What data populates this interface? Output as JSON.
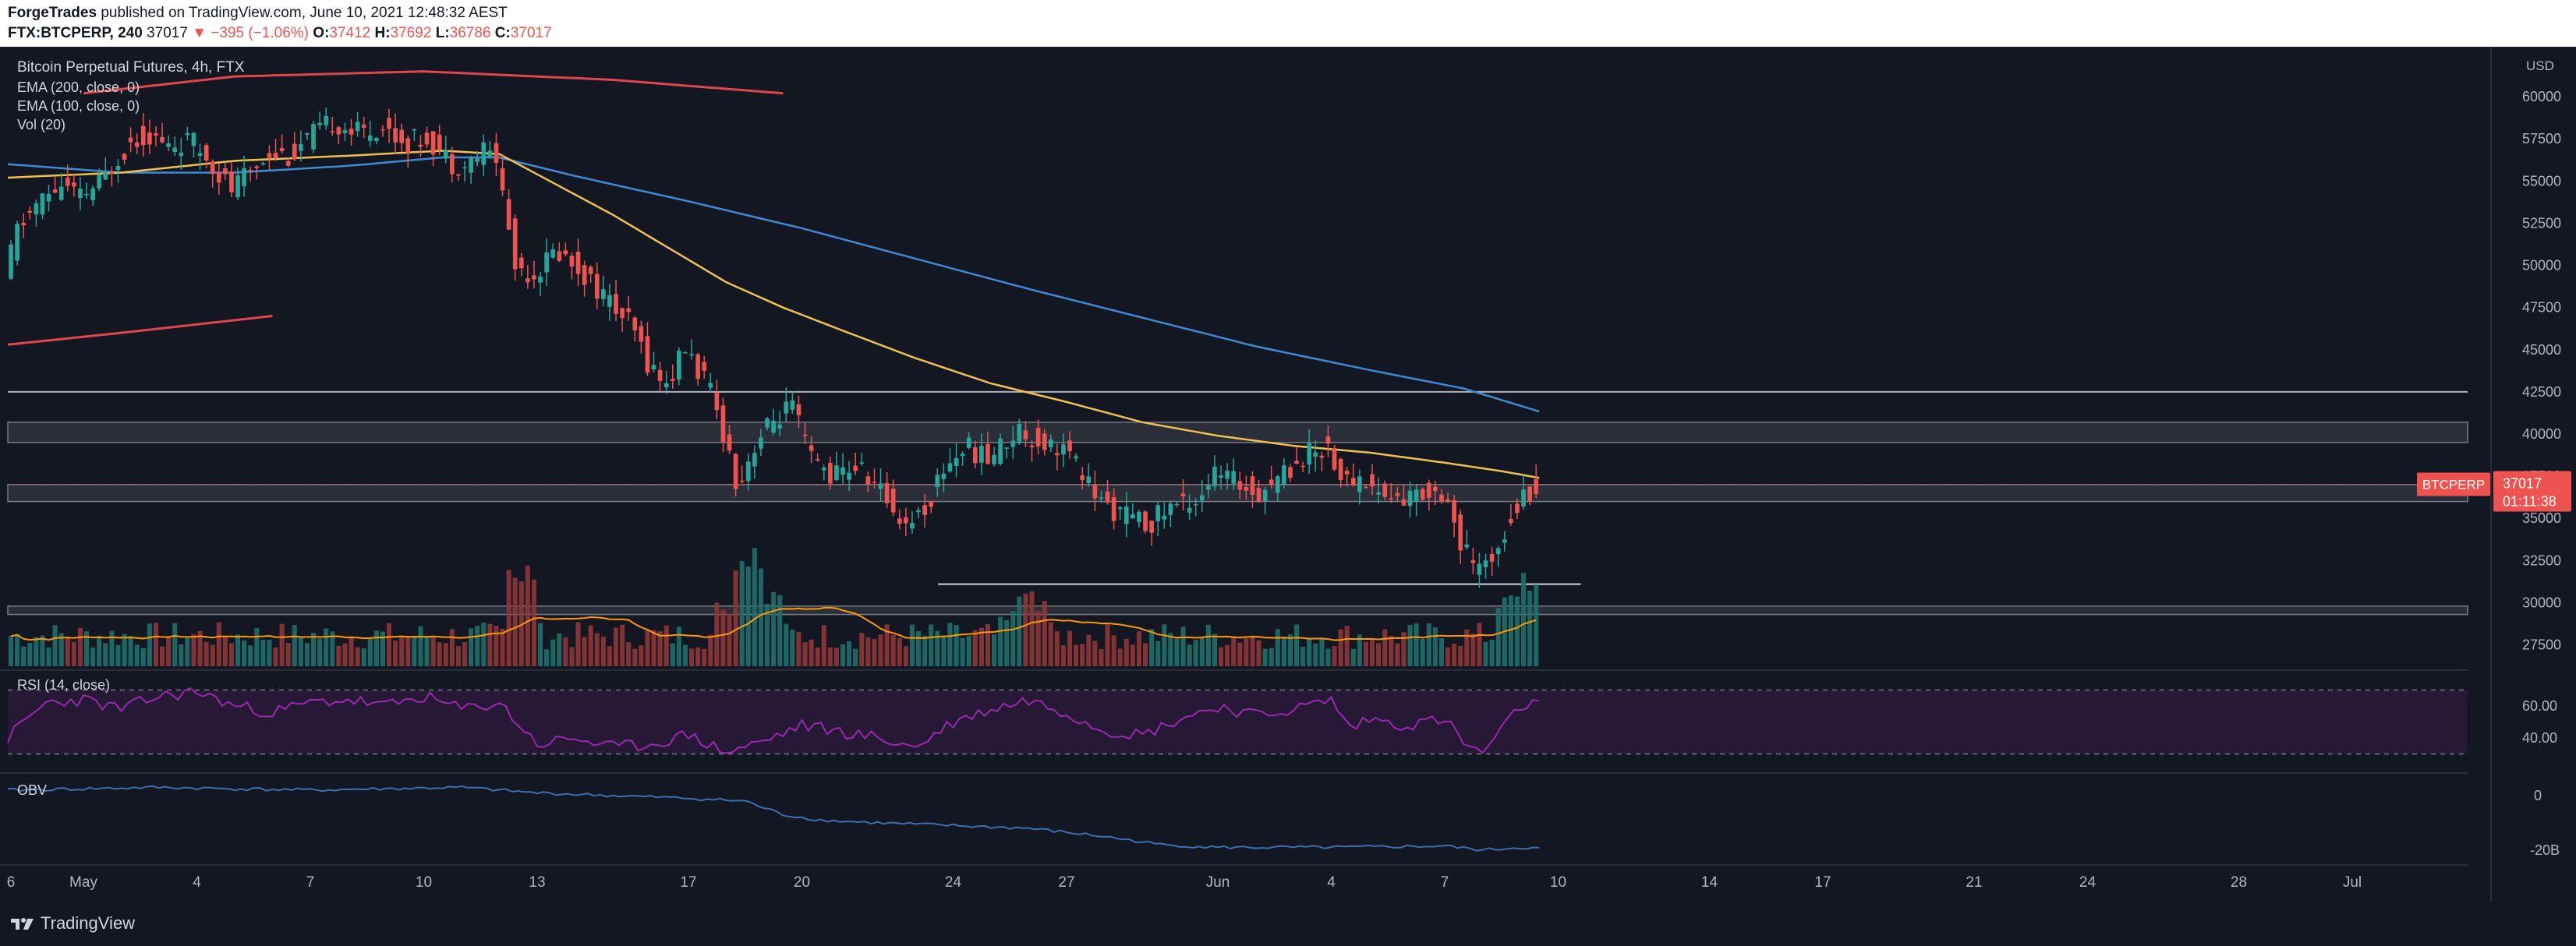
{
  "header": {
    "publisher": "ForgeTrades",
    "published_text": "published on TradingView.com, June 10, 2021 12:48:32 AEST",
    "symbol": "FTX:BTCPERP, 240",
    "last": "37017",
    "change": "−395 (−1.06%)",
    "o_label": "O:",
    "o": "37412",
    "h_label": "H:",
    "h": "37692",
    "l_label": "L:",
    "l": "36786",
    "c_label": "C:",
    "c": "37017"
  },
  "legend": {
    "title": "Bitcoin Perpetual Futures, 4h, FTX",
    "ema200": "EMA (200, close, 0)",
    "ema100": "EMA (100, close, 0)",
    "vol": "Vol (20)"
  },
  "price_tag": {
    "symbol": "BTCPERP",
    "price": "37017",
    "countdown": "01:11:38"
  },
  "footer": {
    "brand": "TradingView"
  },
  "colors": {
    "bg": "#131722",
    "up": "#26a69a",
    "down": "#ef5350",
    "ema100": "#f0c24d",
    "ema200": "#3d8bd8",
    "rsi": "#9c27b0",
    "obv": "#3d6fb0",
    "zone": "#2a2e39",
    "grid": "#1e222d"
  },
  "chart_data": [
    {
      "type": "candlestick",
      "title": "Bitcoin Perpetual Futures, 4h, FTX",
      "currency": "USD",
      "ylim": [
        26000,
        62500
      ],
      "y_ticks": [
        "60000",
        "57500",
        "55000",
        "52500",
        "50000",
        "47500",
        "45000",
        "42500",
        "40000",
        "37500",
        "35000",
        "32500",
        "30000",
        "27500"
      ],
      "x_ticks": [
        "6",
        "May",
        "4",
        "7",
        "10",
        "13",
        "17",
        "20",
        "24",
        "27",
        "Jun",
        "4",
        "7",
        "10",
        "14",
        "17",
        "21",
        "24",
        "28",
        "Jul"
      ],
      "x_tick_day_index": [
        0,
        2,
        5,
        8,
        11,
        14,
        18,
        21,
        25,
        28,
        32,
        35,
        38,
        41,
        45,
        48,
        52,
        55,
        59,
        62
      ],
      "bars_per_day": 6,
      "last_price": 37017,
      "path_points_day_price": [
        [
          0,
          49000
        ],
        [
          0.3,
          52000
        ],
        [
          0.8,
          53500
        ],
        [
          1.5,
          54800
        ],
        [
          2,
          54000
        ],
        [
          2.6,
          55000
        ],
        [
          3,
          56500
        ],
        [
          3.4,
          57500
        ],
        [
          3.8,
          57800
        ],
        [
          4.3,
          57000
        ],
        [
          4.9,
          57400
        ],
        [
          5.4,
          56300
        ],
        [
          6,
          54500
        ],
        [
          6.5,
          55600
        ],
        [
          7,
          56800
        ],
        [
          7.6,
          56500
        ],
        [
          8,
          57500
        ],
        [
          8.7,
          58500
        ],
        [
          9.3,
          57900
        ],
        [
          10,
          58200
        ],
        [
          10.6,
          57300
        ],
        [
          11.2,
          57600
        ],
        [
          11.8,
          56100
        ],
        [
          12.2,
          55900
        ],
        [
          12.7,
          56900
        ],
        [
          13,
          56400
        ],
        [
          13.5,
          50000
        ],
        [
          14,
          49500
        ],
        [
          14.6,
          50900
        ],
        [
          15.2,
          49800
        ],
        [
          16,
          47800
        ],
        [
          16.6,
          46300
        ],
        [
          17,
          44300
        ],
        [
          17.5,
          42900
        ],
        [
          18,
          45100
        ],
        [
          18.6,
          42800
        ],
        [
          19,
          40200
        ],
        [
          19.4,
          36800
        ],
        [
          19.8,
          39300
        ],
        [
          20.3,
          40700
        ],
        [
          20.8,
          41700
        ],
        [
          21.3,
          38600
        ],
        [
          21.9,
          37500
        ],
        [
          22.5,
          38100
        ],
        [
          23,
          37100
        ],
        [
          23.8,
          34700
        ],
        [
          24.4,
          35700
        ],
        [
          24.8,
          37900
        ],
        [
          25.4,
          39300
        ],
        [
          26,
          38500
        ],
        [
          26.8,
          40300
        ],
        [
          27.3,
          39600
        ],
        [
          28,
          39200
        ],
        [
          28.5,
          37600
        ],
        [
          29,
          35900
        ],
        [
          29.6,
          35200
        ],
        [
          30.2,
          34600
        ],
        [
          30.8,
          35700
        ],
        [
          31.5,
          36200
        ],
        [
          32,
          37600
        ],
        [
          32.6,
          37100
        ],
        [
          33.2,
          36600
        ],
        [
          33.8,
          37700
        ],
        [
          34.5,
          38900
        ],
        [
          35,
          39300
        ],
        [
          35.4,
          37100
        ],
        [
          35.9,
          37400
        ],
        [
          36.5,
          36300
        ],
        [
          37,
          36100
        ],
        [
          37.6,
          36600
        ],
        [
          38.1,
          36700
        ],
        [
          38.5,
          33300
        ],
        [
          39,
          31800
        ],
        [
          39.4,
          33100
        ],
        [
          39.9,
          35600
        ],
        [
          40.3,
          36600
        ],
        [
          40.6,
          37017
        ]
      ],
      "ema100_points_day_price": [
        [
          0,
          55200
        ],
        [
          3,
          55500
        ],
        [
          6,
          56200
        ],
        [
          9,
          56500
        ],
        [
          11.5,
          56800
        ],
        [
          13,
          56600
        ],
        [
          14.5,
          54800
        ],
        [
          16,
          53000
        ],
        [
          17.5,
          51000
        ],
        [
          19,
          49000
        ],
        [
          20.5,
          47500
        ],
        [
          22,
          46200
        ],
        [
          24,
          44500
        ],
        [
          26,
          43000
        ],
        [
          28,
          41900
        ],
        [
          30,
          40700
        ],
        [
          32,
          39900
        ],
        [
          34,
          39300
        ],
        [
          36,
          38900
        ],
        [
          38,
          38300
        ],
        [
          39.5,
          37800
        ],
        [
          40.5,
          37400
        ]
      ],
      "ema200_points_day_price": [
        [
          0,
          56000
        ],
        [
          3,
          55500
        ],
        [
          6,
          55500
        ],
        [
          9,
          55900
        ],
        [
          11.5,
          56400
        ],
        [
          13,
          56400
        ],
        [
          15,
          55300
        ],
        [
          18,
          53800
        ],
        [
          21,
          52200
        ],
        [
          24,
          50400
        ],
        [
          27,
          48600
        ],
        [
          30,
          46900
        ],
        [
          33,
          45200
        ],
        [
          36,
          43800
        ],
        [
          38.5,
          42700
        ],
        [
          40.7,
          41200
        ]
      ],
      "upper_arc_points_day_price": [
        [
          2,
          60200
        ],
        [
          6,
          61200
        ],
        [
          11,
          61500
        ],
        [
          16,
          61000
        ],
        [
          20.5,
          60200
        ]
      ],
      "lower_arc_points_day_price": [
        [
          0,
          45300
        ],
        [
          3,
          46000
        ],
        [
          7,
          47000
        ]
      ],
      "horizontal_levels": [
        {
          "type": "line",
          "price": 42500
        },
        {
          "type": "zone",
          "from": 39500,
          "to": 40700
        },
        {
          "type": "zone",
          "from": 36000,
          "to": 37000
        },
        {
          "type": "zone",
          "from": 29300,
          "to": 29800
        },
        {
          "type": "segment",
          "price": 31100,
          "from_day": 24.6,
          "to_day": 41.6
        }
      ],
      "volume_hint": "relative bar heights, spikes near days 13.5, 19-20, 27, 39.5-40"
    },
    {
      "type": "line",
      "title": "RSI (14, close)",
      "ylim": [
        20,
        80
      ],
      "y_ticks": [
        "60.00",
        "40.00"
      ],
      "bands": [
        70,
        30
      ],
      "points_day_value": [
        [
          0,
          40
        ],
        [
          1,
          62
        ],
        [
          2,
          64
        ],
        [
          3,
          58
        ],
        [
          4,
          66
        ],
        [
          5,
          69
        ],
        [
          6,
          60
        ],
        [
          7,
          56
        ],
        [
          8,
          62
        ],
        [
          9,
          64
        ],
        [
          10,
          60
        ],
        [
          11,
          66
        ],
        [
          12,
          58
        ],
        [
          13,
          62
        ],
        [
          14,
          36
        ],
        [
          15,
          40
        ],
        [
          16,
          34
        ],
        [
          17,
          36
        ],
        [
          18,
          42
        ],
        [
          19,
          31
        ],
        [
          20,
          38
        ],
        [
          21,
          48
        ],
        [
          22,
          44
        ],
        [
          23,
          40
        ],
        [
          24,
          34
        ],
        [
          25,
          50
        ],
        [
          26,
          58
        ],
        [
          27,
          64
        ],
        [
          28,
          56
        ],
        [
          29,
          45
        ],
        [
          30,
          42
        ],
        [
          31,
          52
        ],
        [
          32,
          60
        ],
        [
          33,
          54
        ],
        [
          34,
          58
        ],
        [
          35,
          64
        ],
        [
          35.5,
          46
        ],
        [
          36,
          52
        ],
        [
          37,
          48
        ],
        [
          38,
          52
        ],
        [
          38.6,
          34
        ],
        [
          39,
          31
        ],
        [
          39.5,
          44
        ],
        [
          40,
          60
        ],
        [
          40.6,
          62
        ]
      ]
    },
    {
      "type": "line",
      "title": "OBV",
      "y_ticks": [
        "0",
        "-20B"
      ],
      "ylim": [
        -24,
        6
      ],
      "points_day_value": [
        [
          0,
          2
        ],
        [
          4,
          3
        ],
        [
          8,
          2
        ],
        [
          12,
          3
        ],
        [
          14,
          1
        ],
        [
          16,
          0
        ],
        [
          18,
          -1
        ],
        [
          19.5,
          -2
        ],
        [
          20.5,
          -7
        ],
        [
          21.5,
          -9
        ],
        [
          23,
          -10
        ],
        [
          25,
          -11
        ],
        [
          27,
          -12
        ],
        [
          29,
          -15
        ],
        [
          30.5,
          -18
        ],
        [
          32,
          -19
        ],
        [
          35,
          -19
        ],
        [
          38,
          -18.5
        ],
        [
          39,
          -20
        ],
        [
          40,
          -19
        ],
        [
          40.6,
          -19.5
        ]
      ]
    }
  ]
}
